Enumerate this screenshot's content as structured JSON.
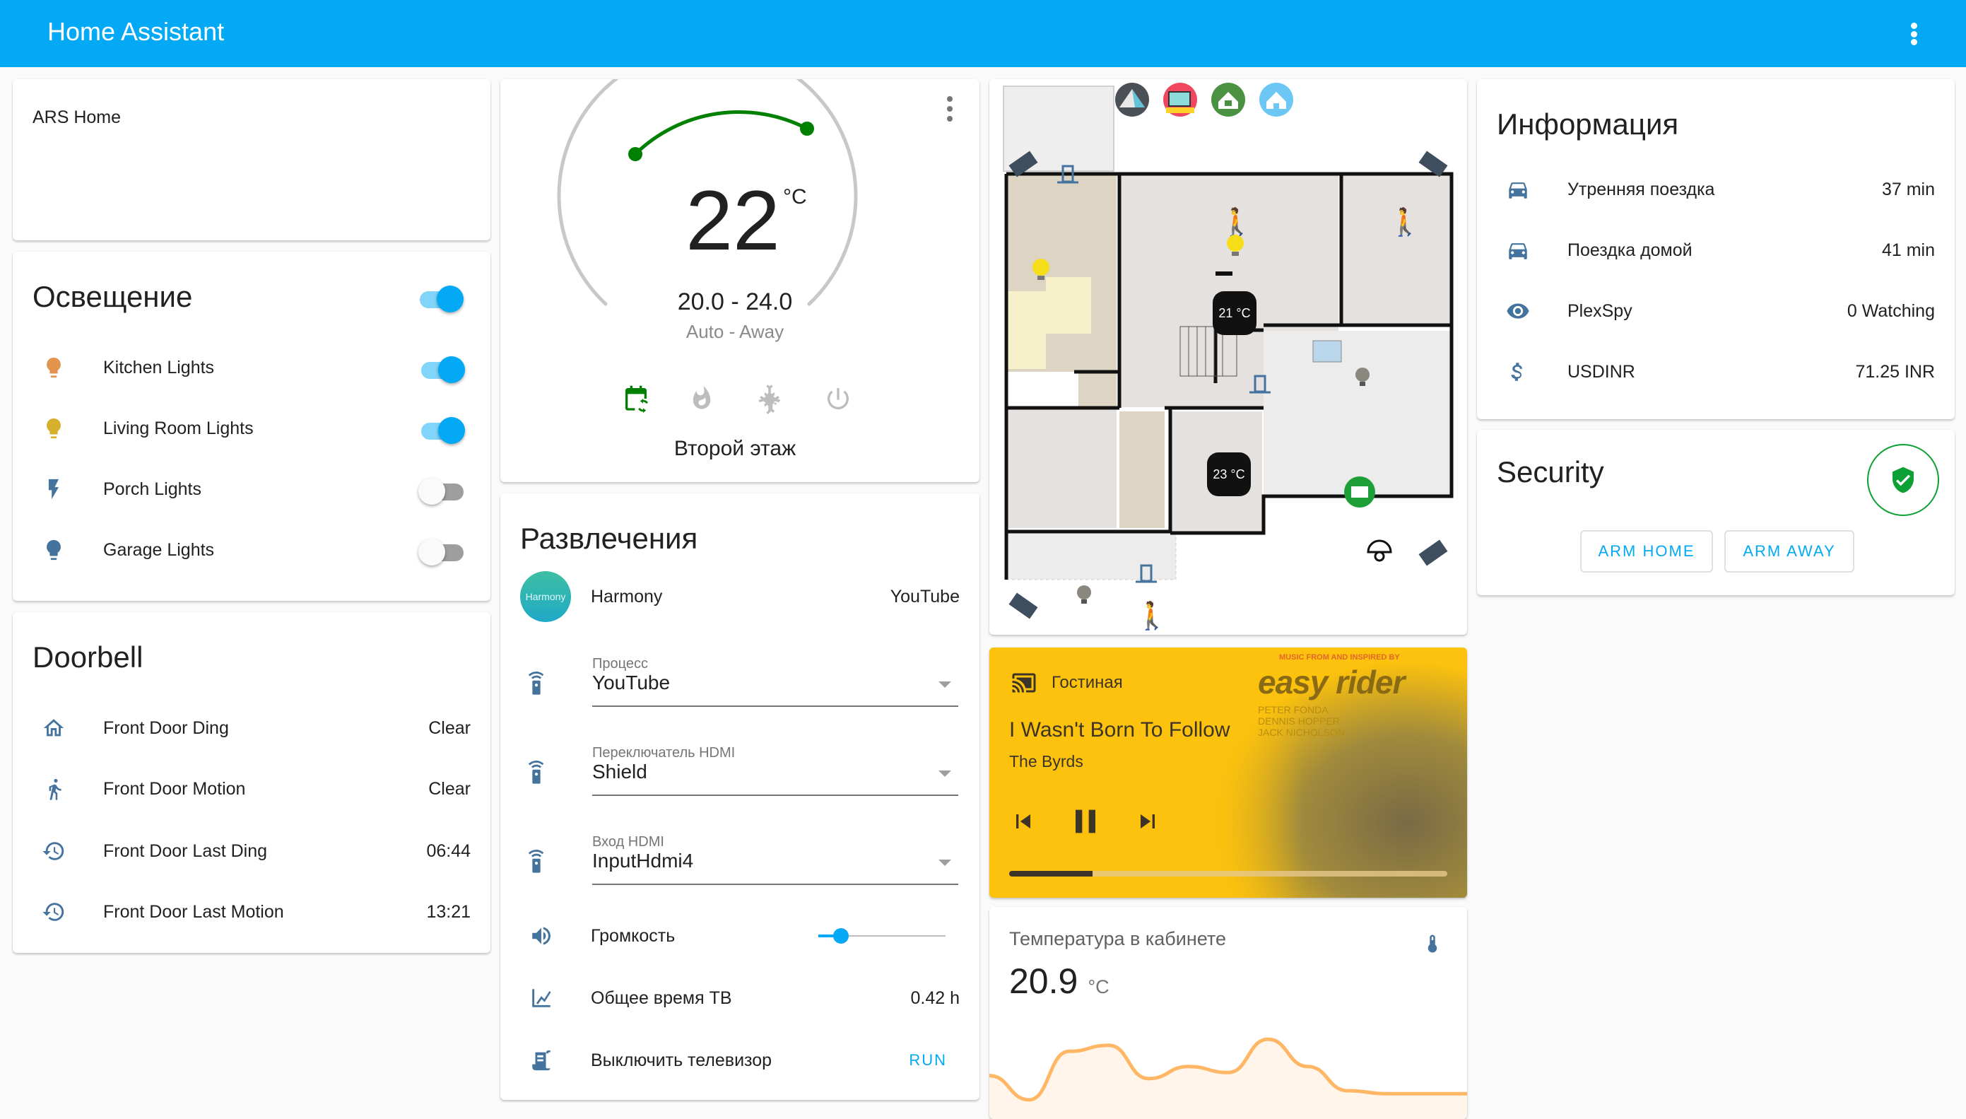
{
  "header": {
    "title": "Home Assistant",
    "menu_icon": "dots-vertical-icon"
  },
  "ars_card": {
    "title": "ARS Home"
  },
  "lighting": {
    "title": "Освещение",
    "master_on": true,
    "items": [
      {
        "label": "Kitchen Lights",
        "icon": "lightbulb-icon",
        "icon_color": "#E2944F",
        "on": true
      },
      {
        "label": "Living Room Lights",
        "icon": "lightbulb-icon",
        "icon_color": "#D7B02B",
        "on": true
      },
      {
        "label": "Porch Lights",
        "icon": "flash-icon",
        "icon_color": "#44739E",
        "on": false
      },
      {
        "label": "Garage Lights",
        "icon": "lightbulb-icon",
        "icon_color": "#44739E",
        "on": false
      }
    ]
  },
  "doorbell": {
    "title": "Doorbell",
    "items": [
      {
        "label": "Front Door Ding",
        "icon": "home-outline-icon",
        "value": "Clear"
      },
      {
        "label": "Front Door Motion",
        "icon": "walk-icon",
        "value": "Clear"
      },
      {
        "label": "Front Door Last Ding",
        "icon": "history-icon",
        "value": "06:44"
      },
      {
        "label": "Front Door Last Motion",
        "icon": "history-icon",
        "value": "13:21"
      }
    ]
  },
  "thermostat": {
    "current": "22",
    "unit": "°C",
    "range": "20.0 - 24.0",
    "mode": "Auto - Away",
    "name": "Второй этаж",
    "modes": [
      "auto-calendar-icon",
      "fire-icon",
      "snowflake-icon",
      "power-icon"
    ],
    "active_mode": "auto-calendar-icon",
    "active_color": "#008000"
  },
  "entertainment": {
    "title": "Развлечения",
    "harmony": {
      "label": "Harmony",
      "logo_text": "Harmony",
      "value": "YouTube"
    },
    "selects": [
      {
        "label": "Процесс",
        "value": "YouTube"
      },
      {
        "label": "Переключатель HDMI",
        "value": "Shield"
      },
      {
        "label": "Вход HDMI",
        "value": "InputHdmi4"
      }
    ],
    "volume": {
      "label": "Громкость",
      "level": 0.18
    },
    "tv_time": {
      "label": "Общее время ТВ",
      "value": "0.42 h"
    },
    "script": {
      "label": "Выключить телевизор",
      "action": "RUN"
    }
  },
  "floorplan": {
    "top_icons": [
      "home-assistant-logo-icon",
      "tv-icon",
      "home-lock-open-icon",
      "smart-home-icon"
    ],
    "thermostats": [
      {
        "label": "21 °C"
      },
      {
        "label": "23 °C"
      }
    ]
  },
  "media": {
    "device": "Гостиная",
    "title": "I Wasn't Born To Follow",
    "artist": "The Byrds",
    "progress": 0.19,
    "bg_color": "#FDC20D",
    "art_heading": "MUSIC FROM AND INSPIRED BY",
    "art_title": "easy rider",
    "art_credits": [
      "PETER FONDA",
      "DENNIS HOPPER",
      "JACK NICHOLSON"
    ]
  },
  "sensor": {
    "title": "Температура в кабинете",
    "value": "20.9",
    "unit": "°C",
    "icon": "thermometer-icon",
    "history": [
      19.6,
      18.8,
      20.4,
      20.6,
      19.5,
      19.9,
      19.7,
      20.8,
      19.9,
      19.1,
      19.0,
      19.0,
      19.0
    ]
  },
  "info": {
    "title": "Информация",
    "items": [
      {
        "label": "Утренняя поездка",
        "icon": "car-icon",
        "value": "37 min"
      },
      {
        "label": "Поездка домой",
        "icon": "car-icon",
        "value": "41 min"
      },
      {
        "label": "PlexSpy",
        "icon": "eye-icon",
        "value": "0 Watching"
      },
      {
        "label": "USDINR",
        "icon": "currency-usd-icon",
        "value": "71.25 INR"
      }
    ]
  },
  "security": {
    "title": "Security",
    "state_icon": "shield-check-icon",
    "state_color": "#0DA035",
    "buttons": [
      "ARM HOME",
      "ARM AWAY"
    ]
  }
}
